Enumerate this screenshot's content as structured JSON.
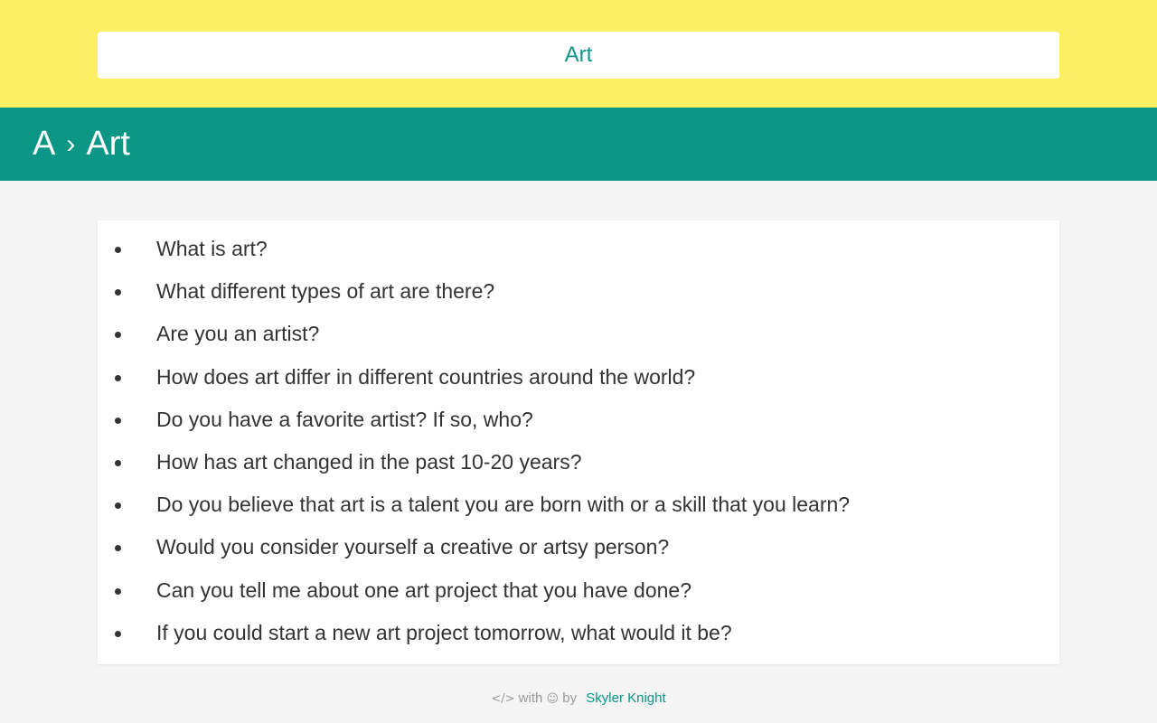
{
  "search": {
    "value": "Art"
  },
  "breadcrumb": {
    "root": "A",
    "separator": "›",
    "current": "Art"
  },
  "questions": [
    "What is art?",
    "What different types of art are there?",
    "Are you an artist?",
    "How does art differ in different countries around the world?",
    "Do you have a favorite artist? If so, who?",
    "How has art changed in the past 10-20 years?",
    "Do you believe that art is a talent you are born with or a skill that you learn?",
    "Would you consider yourself a creative or artsy person?",
    "Can you tell me about one art project that you have done?",
    "If you could start a new art project tomorrow, what would it be?"
  ],
  "footer": {
    "code_icon": "</>",
    "with_text": "with",
    "smile_icon": "☺",
    "by_text": "by",
    "author": "Skyler Knight"
  },
  "colors": {
    "top_bar": "#fdef64",
    "accent": "#0b9686",
    "page_bg": "#f4f4f4",
    "text": "#333333"
  }
}
